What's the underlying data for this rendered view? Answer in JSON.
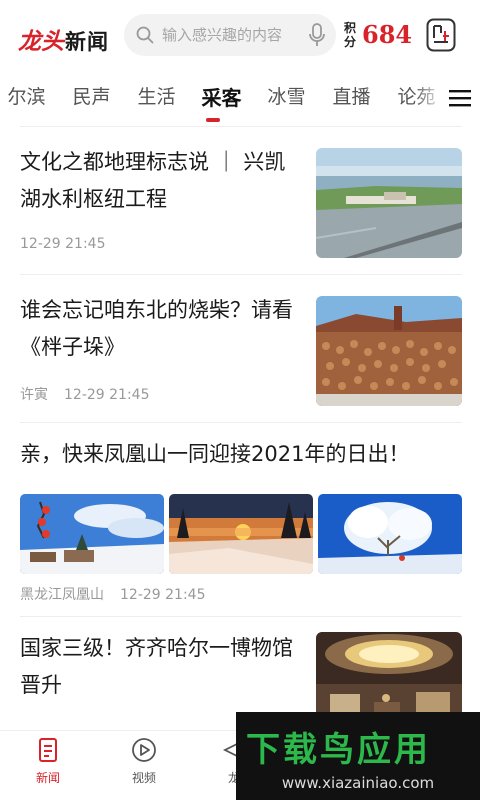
{
  "header": {
    "logo_red": "龙头",
    "logo_black": "新闻",
    "search_placeholder": "输入感兴趣的内容",
    "points_label": "积分",
    "points_value": "684"
  },
  "tabs": {
    "items": [
      "尔滨",
      "民声",
      "生活",
      "采客",
      "冰雪",
      "直播",
      "论苑"
    ],
    "active": "采客"
  },
  "feed": {
    "items": [
      {
        "title": "文化之都地理标志说 ｜ 兴凯湖水利枢纽工程",
        "source": "",
        "time": "12-29 21:45"
      },
      {
        "title": "谁会忘记咱东北的烧柴？请看《柈子垛》",
        "source": "许寅",
        "time": "12-29 21:45"
      },
      {
        "title": "亲，快来凤凰山一同迎接2021年的日出！",
        "source": "黑龙江凤凰山",
        "time": "12-29 21:45"
      },
      {
        "title": "国家三级！齐齐哈尔一博物馆晋升",
        "source": "",
        "time": ""
      }
    ]
  },
  "bottom_nav": {
    "items": [
      {
        "label": "新闻"
      },
      {
        "label": "视频"
      },
      {
        "label": "龙"
      }
    ]
  },
  "watermark": {
    "top": "下载鸟应用",
    "bottom": "www.xiazainiao.com"
  },
  "colors": {
    "brand_red": "#d8232a",
    "watermark_green": "#2db84b"
  }
}
